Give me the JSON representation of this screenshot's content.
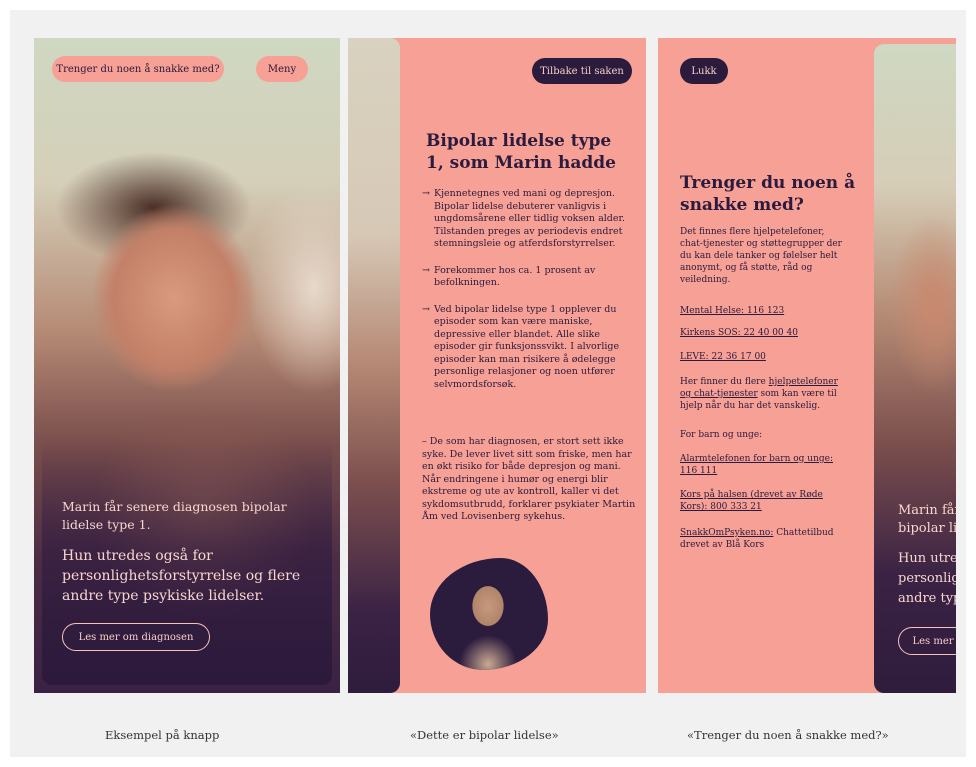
{
  "panel1": {
    "help_button": "Trenger du noen å snakke med?",
    "menu_button": "Meny",
    "caption_small": "Marin får senere diagnosen bipolar lidelse type 1.",
    "caption_large": "Hun utredes også for personlighetsforstyrrelse og flere andre type psykiske lidelser.",
    "read_more_button": "Les mer om diagnosen"
  },
  "panel2": {
    "back_button": "Tilbake til saken",
    "title": "Bipolar lidelse type 1, som Marin hadde",
    "bullets": [
      "Kjennetegnes ved mani og depresjon. Bipolar lidelse debuterer vanligvis i ungdomsårene eller tidlig voksen alder. Tilstanden preges av periodevis endret stemningsleie og atferdsforstyrrelser.",
      "Forekommer hos ca. 1 prosent av befolkningen.",
      "Ved bipolar lidelse type 1 opplever du episoder som kan være maniske, depressive eller blandet. Alle slike episoder gir funksjonssvikt. I alvorlige episoder kan man risikere å ødelegge personlige relasjoner og noen utfører selvmordsforsøk."
    ],
    "bullet_marker": "→",
    "quote": "– De som har diagnosen, er stort sett ikke syke. De lever livet sitt som friske, men har en økt risiko for både depresjon og mani. Når endringene i humør og energi blir ekstreme og ute av kontroll, kaller vi det sykdomsutbrudd, forklarer psykiater Martin Åm ved Lovisenberg sykehus."
  },
  "panel3": {
    "close_button": "Lukk",
    "title": "Trenger du noen å snakke med?",
    "intro": "Det finnes flere hjelpetelefoner, chat-tjenester og støttegrupper der du kan dele tanker og følelser helt anonymt, og få støtte, råd og veiledning.",
    "mental_helse": "Mental Helse: 116 123",
    "kirkens_sos": "Kirkens SOS: 22 40 00 40",
    "leve": "LEVE: 22 36 17 00",
    "more_prefix": "Her finner du flere ",
    "more_link": "hjelpetelefoner og chat-tjenester",
    "more_suffix": " som kan være til hjelp når du har det vanskelig.",
    "kids_heading": "For barn og unge:",
    "alarm": "Alarmtelefonen for barn og unge: 116 111",
    "kors": "Kors på halsen (drevet av Røde Kors): 800 333 21",
    "snakk_link": "SnakkOmPsyken.no:",
    "snakk_suffix": " Chattetilbud drevet av Blå Kors",
    "peek_caption_1": "Marin får",
    "peek_caption_2": "bipolar li",
    "peek_caption_3": "Hun utre",
    "peek_caption_4": "personlig",
    "peek_caption_5": "andre typ",
    "peek_button": "Les mer"
  },
  "captions": {
    "a": "Eksempel på knapp",
    "b": "«Dette er bipolar lidelse»",
    "c": "«Trenger du noen å snakke med?»"
  },
  "colors": {
    "coral": "#f7a096",
    "aubergine": "#2b1b3d",
    "background": "#f1f1f1"
  }
}
